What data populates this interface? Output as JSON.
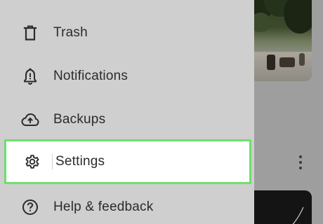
{
  "drawer": {
    "items": [
      {
        "label": "Trash",
        "icon": "trash-icon"
      },
      {
        "label": "Notifications",
        "icon": "bell-icon"
      },
      {
        "label": "Backups",
        "icon": "cloud-upload-icon"
      },
      {
        "label": "Settings",
        "icon": "gear-icon",
        "highlighted": true
      },
      {
        "label": "Help & feedback",
        "icon": "help-icon"
      }
    ]
  },
  "colors": {
    "drawer_background": "#cfcfcf",
    "highlight_background": "#ffffff",
    "highlight_border": "#6ee06a",
    "text": "#2b2b2b",
    "icon": "#2b2b2b"
  }
}
